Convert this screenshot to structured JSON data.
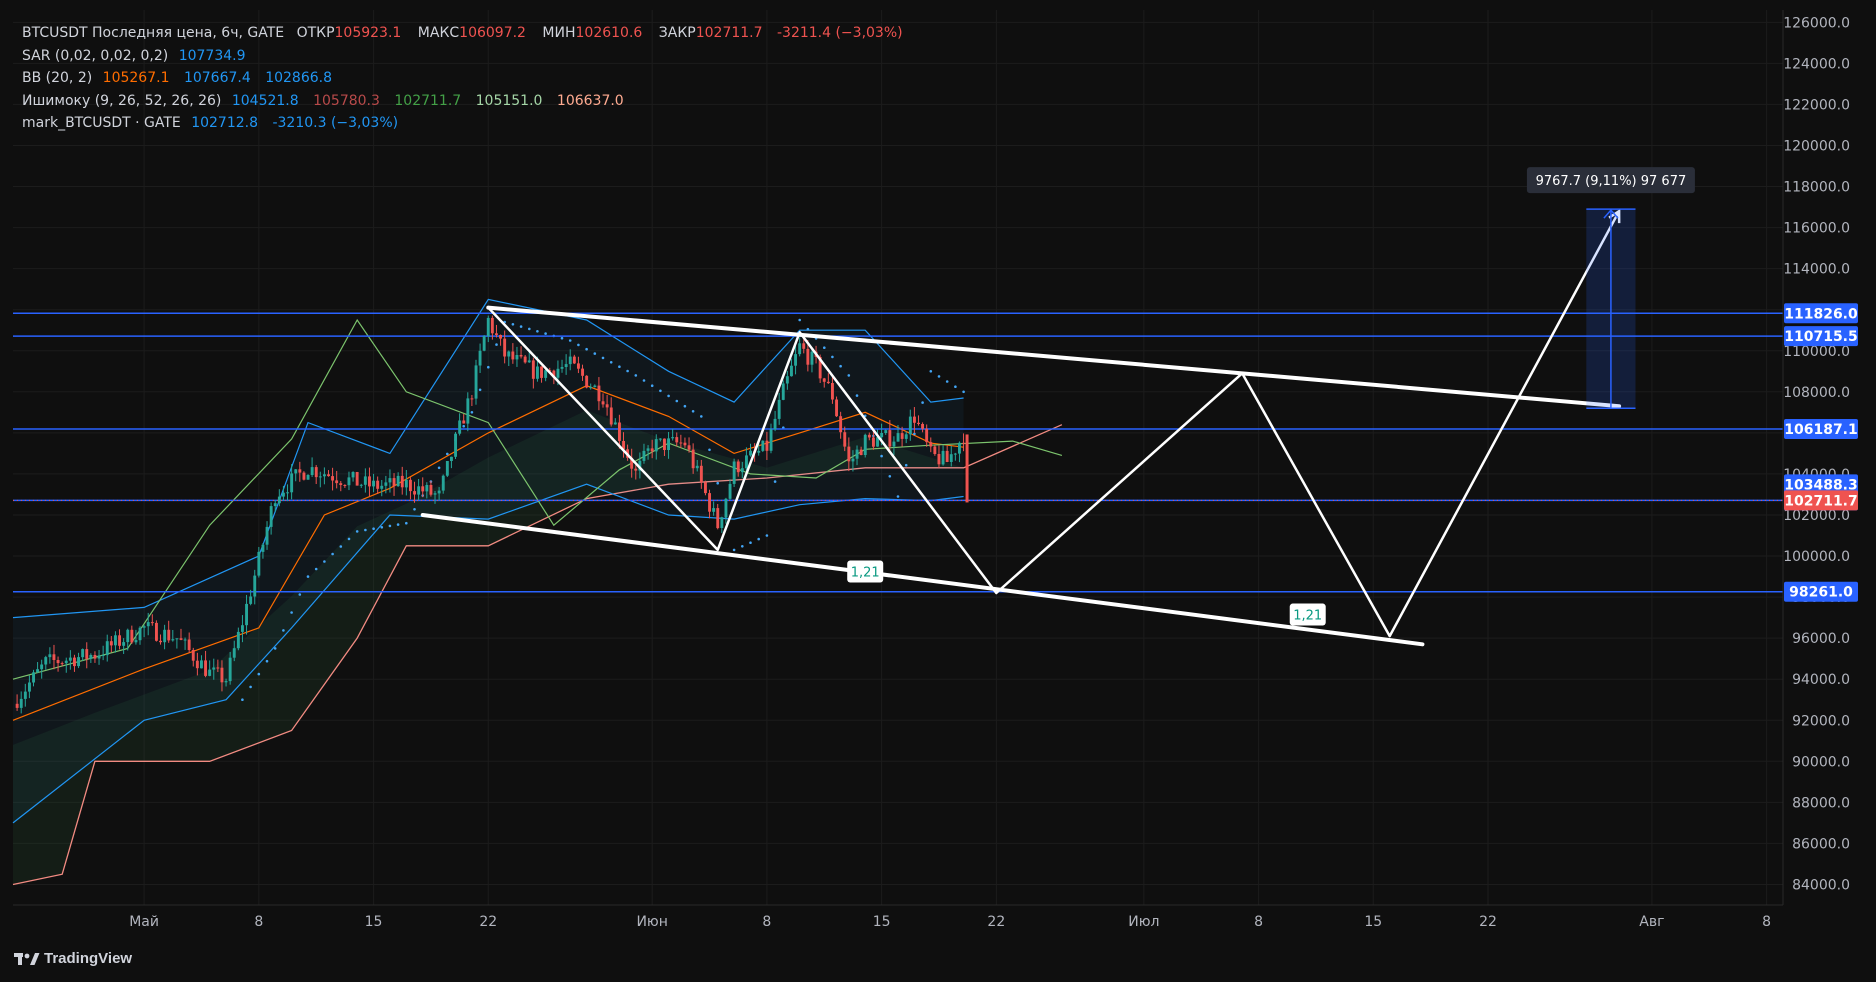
{
  "legend": {
    "main": {
      "label": "BTCUSDT Последняя цена, 6ч, GATE",
      "open_key": "ОТКР",
      "open": "105923.1",
      "high_key": "МАКС",
      "high": "106097.2",
      "low_key": "МИН",
      "low": "102610.6",
      "close_key": "ЗАКР",
      "close": "102711.7",
      "change": "-3211.4 (−3,03%)"
    },
    "sar": {
      "label": "SAR (0,02, 0,02, 0,2)",
      "v1": "107734.9"
    },
    "bb": {
      "label": "BB (20, 2)",
      "v1": "105267.1",
      "v2": "107667.4",
      "v3": "102866.8"
    },
    "ichimoku": {
      "label": "Ишимоку (9, 26, 52, 26, 26)",
      "v1": "104521.8",
      "v2": "105780.3",
      "v3": "102711.7",
      "v4": "105151.0",
      "v5": "106637.0"
    },
    "mark": {
      "label": "mark_BTCUSDT · GATE",
      "v1": "102712.8",
      "v2": "-3210.3 (−3,03%)"
    }
  },
  "branding": "TradingView",
  "colors": {
    "background": "#0f0f0f",
    "level_line": "#2962ff",
    "pattern": "#ffffff",
    "up": "#26a69a",
    "down": "#ef5350",
    "bb": "#2196f3",
    "basis": "#ff6d00",
    "lagging": "#7cc46d",
    "span": "#f28b82",
    "sar": "#42a5f5"
  },
  "chart_data": {
    "type": "candlestick",
    "y_axis": {
      "min": 83000,
      "max": 126600,
      "ticks": [
        "126000.0",
        "124000.0",
        "122000.0",
        "120000.0",
        "118000.0",
        "116000.0",
        "114000.0",
        "112000.0",
        "110000.0",
        "108000.0",
        "106000.0",
        "104000.0",
        "102000.0",
        "100000.0",
        "98000.0",
        "96000.0",
        "94000.0",
        "92000.0",
        "90000.0",
        "88000.0",
        "86000.0",
        "84000.0"
      ]
    },
    "x_axis": {
      "start": "2025-04-23",
      "end": "2025-08-09",
      "ticks": [
        {
          "date": "2025-05-01",
          "label": "Май"
        },
        {
          "date": "2025-05-08",
          "label": "8"
        },
        {
          "date": "2025-05-15",
          "label": "15"
        },
        {
          "date": "2025-05-22",
          "label": "22"
        },
        {
          "date": "2025-06-01",
          "label": "Июн"
        },
        {
          "date": "2025-06-08",
          "label": "8"
        },
        {
          "date": "2025-06-15",
          "label": "15"
        },
        {
          "date": "2025-06-22",
          "label": "22"
        },
        {
          "date": "2025-07-01",
          "label": "Июл"
        },
        {
          "date": "2025-07-08",
          "label": "8"
        },
        {
          "date": "2025-07-15",
          "label": "15"
        },
        {
          "date": "2025-07-22",
          "label": "22"
        },
        {
          "date": "2025-08-01",
          "label": "Авг"
        },
        {
          "date": "2025-08-08",
          "label": "8"
        }
      ]
    },
    "price_path": [
      [
        "2025-04-23",
        92800
      ],
      [
        "2025-04-25",
        94800
      ],
      [
        "2025-04-28",
        95200
      ],
      [
        "2025-05-01",
        96500
      ],
      [
        "2025-05-03",
        96000
      ],
      [
        "2025-05-05",
        94300
      ],
      [
        "2025-05-06",
        94000
      ],
      [
        "2025-05-07",
        96800
      ],
      [
        "2025-05-08",
        99800
      ],
      [
        "2025-05-09",
        103000
      ],
      [
        "2025-05-11",
        104300
      ],
      [
        "2025-05-13",
        103800
      ],
      [
        "2025-05-15",
        103400
      ],
      [
        "2025-05-17",
        103500
      ],
      [
        "2025-05-19",
        102900
      ],
      [
        "2025-05-20",
        105600
      ],
      [
        "2025-05-21",
        108000
      ],
      [
        "2025-05-22",
        111500
      ],
      [
        "2025-05-23",
        109800
      ],
      [
        "2025-05-25",
        108900
      ],
      [
        "2025-05-27",
        109300
      ],
      [
        "2025-05-29",
        107800
      ],
      [
        "2025-05-31",
        104000
      ],
      [
        "2025-06-01",
        105400
      ],
      [
        "2025-06-03",
        105500
      ],
      [
        "2025-06-05",
        101500
      ],
      [
        "2025-06-06",
        104300
      ],
      [
        "2025-06-08",
        105300
      ],
      [
        "2025-06-09",
        108000
      ],
      [
        "2025-06-10",
        110200
      ],
      [
        "2025-06-11",
        109300
      ],
      [
        "2025-06-12",
        107800
      ],
      [
        "2025-06-13",
        104500
      ],
      [
        "2025-06-14",
        105600
      ],
      [
        "2025-06-16",
        105800
      ],
      [
        "2025-06-17",
        106800
      ],
      [
        "2025-06-18",
        104900
      ],
      [
        "2025-06-19",
        104600
      ],
      [
        "2025-06-20",
        105900
      ],
      [
        "2025-06-20",
        102712
      ]
    ],
    "bollinger": {
      "upper": [
        [
          "2025-04-23",
          97000
        ],
        [
          "2025-05-01",
          97500
        ],
        [
          "2025-05-08",
          100000
        ],
        [
          "2025-05-11",
          106500
        ],
        [
          "2025-05-16",
          105000
        ],
        [
          "2025-05-22",
          112500
        ],
        [
          "2025-05-28",
          111500
        ],
        [
          "2025-06-02",
          109000
        ],
        [
          "2025-06-06",
          107500
        ],
        [
          "2025-06-10",
          111000
        ],
        [
          "2025-06-14",
          111000
        ],
        [
          "2025-06-18",
          107500
        ],
        [
          "2025-06-20",
          107700
        ]
      ],
      "basis": [
        [
          "2025-04-23",
          92000
        ],
        [
          "2025-05-01",
          94500
        ],
        [
          "2025-05-08",
          96500
        ],
        [
          "2025-05-12",
          102000
        ],
        [
          "2025-05-16",
          103300
        ],
        [
          "2025-05-22",
          106000
        ],
        [
          "2025-05-28",
          108300
        ],
        [
          "2025-06-02",
          106800
        ],
        [
          "2025-06-06",
          105000
        ],
        [
          "2025-06-10",
          106000
        ],
        [
          "2025-06-14",
          107000
        ],
        [
          "2025-06-18",
          105500
        ],
        [
          "2025-06-20",
          105300
        ]
      ],
      "lower": [
        [
          "2025-04-23",
          87000
        ],
        [
          "2025-05-01",
          92000
        ],
        [
          "2025-05-06",
          93000
        ],
        [
          "2025-05-10",
          96500
        ],
        [
          "2025-05-16",
          102000
        ],
        [
          "2025-05-22",
          101800
        ],
        [
          "2025-05-28",
          103500
        ],
        [
          "2025-06-02",
          102000
        ],
        [
          "2025-06-06",
          101800
        ],
        [
          "2025-06-10",
          102500
        ],
        [
          "2025-06-14",
          102800
        ],
        [
          "2025-06-18",
          102700
        ],
        [
          "2025-06-20",
          102900
        ]
      ]
    },
    "ichimoku_lagging": [
      [
        "2025-04-23",
        94000
      ],
      [
        "2025-04-30",
        95500
      ],
      [
        "2025-05-05",
        101500
      ],
      [
        "2025-05-10",
        105700
      ],
      [
        "2025-05-14",
        111500
      ],
      [
        "2025-05-17",
        108000
      ],
      [
        "2025-05-22",
        106500
      ],
      [
        "2025-05-26",
        101500
      ],
      [
        "2025-05-30",
        104200
      ],
      [
        "2025-06-02",
        105500
      ],
      [
        "2025-06-07",
        104000
      ],
      [
        "2025-06-11",
        103800
      ],
      [
        "2025-06-14",
        105200
      ],
      [
        "2025-06-18",
        105400
      ],
      [
        "2025-06-23",
        105600
      ],
      [
        "2025-06-26",
        104900
      ]
    ],
    "ichimoku_span_b": [
      [
        "2025-04-23",
        84000
      ],
      [
        "2025-04-26",
        84500
      ],
      [
        "2025-04-28",
        90000
      ],
      [
        "2025-05-05",
        90000
      ],
      [
        "2025-05-10",
        91500
      ],
      [
        "2025-05-14",
        96000
      ],
      [
        "2025-05-17",
        100500
      ],
      [
        "2025-05-22",
        100500
      ],
      [
        "2025-05-28",
        102800
      ],
      [
        "2025-06-02",
        103500
      ],
      [
        "2025-06-08",
        103800
      ],
      [
        "2025-06-14",
        104300
      ],
      [
        "2025-06-20",
        104300
      ],
      [
        "2025-06-26",
        106400
      ]
    ],
    "parabolic_sar": [
      [
        "2025-05-07",
        93000
      ],
      [
        "2025-05-09",
        95500
      ],
      [
        "2025-05-11",
        99000
      ],
      [
        "2025-05-14",
        101200
      ],
      [
        "2025-05-17",
        101600
      ],
      [
        "2025-05-21",
        107000
      ],
      [
        "2025-05-23",
        111400
      ],
      [
        "2025-05-27",
        110500
      ],
      [
        "2025-05-31",
        108800
      ],
      [
        "2025-06-04",
        106800
      ],
      [
        "2025-06-06",
        100300
      ],
      [
        "2025-06-08",
        101000
      ],
      [
        "2025-06-10",
        111500
      ],
      [
        "2025-06-13",
        108800
      ],
      [
        "2025-06-16",
        102900
      ],
      [
        "2025-06-18",
        109000
      ],
      [
        "2025-06-20",
        108000
      ]
    ],
    "horizontal_levels": [
      111826.0,
      110715.5,
      106187.1,
      102711.7,
      98261.0
    ],
    "current_price_line": 102711.7,
    "price_labels": [
      {
        "value": 111826.0,
        "text": "111826.0",
        "kind": "level"
      },
      {
        "value": 110715.5,
        "text": "110715.5",
        "kind": "level"
      },
      {
        "value": 106187.1,
        "text": "106187.1",
        "kind": "level"
      },
      {
        "value": 103488.3,
        "text": "103488.3",
        "kind": "indicator"
      },
      {
        "value": 102712.8,
        "text": "102712.8",
        "kind": "indicator"
      },
      {
        "value": 102711.7,
        "text": "102711.7",
        "kind": "price"
      },
      {
        "value": 98261.0,
        "text": "98261.0",
        "kind": "level"
      }
    ],
    "trendlines": [
      {
        "from": [
          "2025-05-22",
          112100
        ],
        "to": [
          "2025-07-30",
          107300
        ]
      },
      {
        "from": [
          "2025-05-18",
          102000
        ],
        "to": [
          "2025-07-18",
          95700
        ]
      }
    ],
    "zigzag": [
      [
        "2025-05-22",
        112100
      ],
      [
        "2025-06-05",
        100300
      ],
      [
        "2025-06-10",
        110900
      ],
      [
        "2025-06-22",
        98200
      ],
      [
        "2025-07-07",
        108900
      ],
      [
        "2025-07-16",
        96100
      ],
      [
        "2025-07-30",
        116800
      ]
    ],
    "fib_labels": [
      {
        "date": "2025-06-14",
        "value": 99200,
        "text": "1,21"
      },
      {
        "date": "2025-07-11",
        "value": 97100,
        "text": "1,21"
      }
    ],
    "measure": {
      "date_from": "2025-07-28",
      "date_to": "2025-07-31",
      "from": 107200,
      "to": 116900,
      "text": "9767.7 (9,11%) 97 677"
    }
  }
}
